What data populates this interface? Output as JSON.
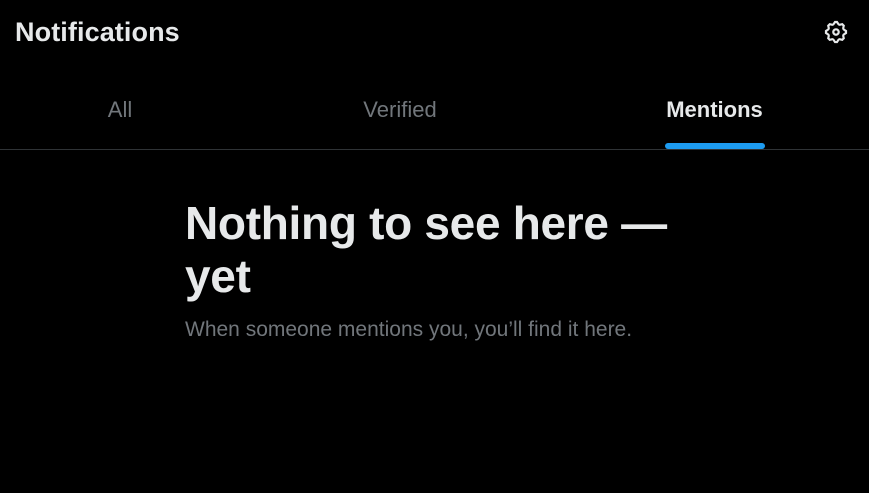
{
  "header": {
    "title": "Notifications",
    "settings_icon": "gear-icon"
  },
  "tabs": [
    {
      "label": "All",
      "active": false
    },
    {
      "label": "Verified",
      "active": false
    },
    {
      "label": "Mentions",
      "active": true
    }
  ],
  "empty_state": {
    "title": "Nothing to see here — yet",
    "subtitle": "When someone mentions you, you’ll find it here."
  },
  "colors": {
    "background": "#000000",
    "primary_text": "#e7e9ea",
    "secondary_text": "#71767b",
    "accent": "#1d9bf0",
    "divider": "#2f3336"
  }
}
